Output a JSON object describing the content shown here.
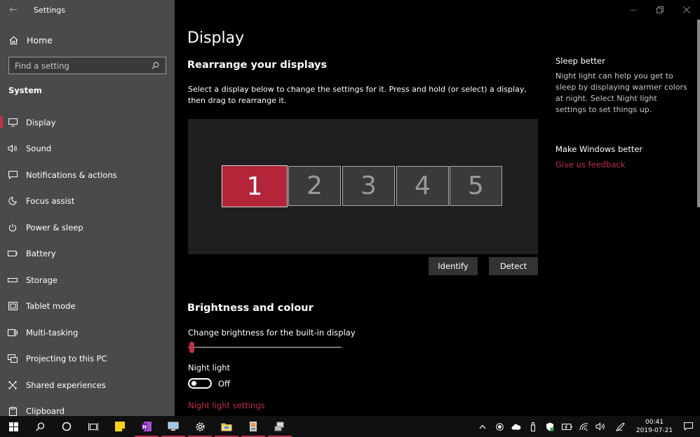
{
  "window": {
    "app_title": "Settings",
    "icons": {
      "back": "back-arrow-icon",
      "minimize": "minimize-icon",
      "maximize": "restore-icon",
      "close": "close-icon"
    }
  },
  "sidebar": {
    "home_label": "Home",
    "search_placeholder": "Find a setting",
    "section_label": "System",
    "items": [
      {
        "label": "Display",
        "icon": "monitor-icon",
        "active": true
      },
      {
        "label": "Sound",
        "icon": "speaker-icon"
      },
      {
        "label": "Notifications & actions",
        "icon": "notification-icon"
      },
      {
        "label": "Focus assist",
        "icon": "moon-icon"
      },
      {
        "label": "Power & sleep",
        "icon": "power-icon"
      },
      {
        "label": "Battery",
        "icon": "battery-icon"
      },
      {
        "label": "Storage",
        "icon": "storage-icon"
      },
      {
        "label": "Tablet mode",
        "icon": "tablet-icon"
      },
      {
        "label": "Multi-tasking",
        "icon": "multitask-icon"
      },
      {
        "label": "Projecting to this PC",
        "icon": "project-icon"
      },
      {
        "label": "Shared experiences",
        "icon": "shared-icon"
      },
      {
        "label": "Clipboard",
        "icon": "clipboard-icon"
      }
    ]
  },
  "main": {
    "page_title": "Display",
    "rearrange": {
      "heading": "Rearrange your displays",
      "description": "Select a display below to change the settings for it. Press and hold (or select) a display, then drag to rearrange it.",
      "monitors": [
        "1",
        "2",
        "3",
        "4",
        "5"
      ],
      "selected_monitor": "1",
      "identify_label": "Identify",
      "detect_label": "Detect"
    },
    "brightness": {
      "heading": "Brightness and colour",
      "slider_label": "Change brightness for the built-in display",
      "slider_value": 0.01,
      "night_light_label": "Night light",
      "night_light_state": "Off",
      "night_light_settings_link": "Night light settings"
    }
  },
  "aside": {
    "sleep_heading": "Sleep better",
    "sleep_text": "Night light can help you get to sleep by displaying warmer colors at night. Select Night light settings to set things up.",
    "feedback_heading": "Make Windows better",
    "feedback_link": "Give us feedback"
  },
  "taskbar": {
    "time": "00:41",
    "date": "2019-07-21",
    "accent_color": "#c0314a"
  }
}
